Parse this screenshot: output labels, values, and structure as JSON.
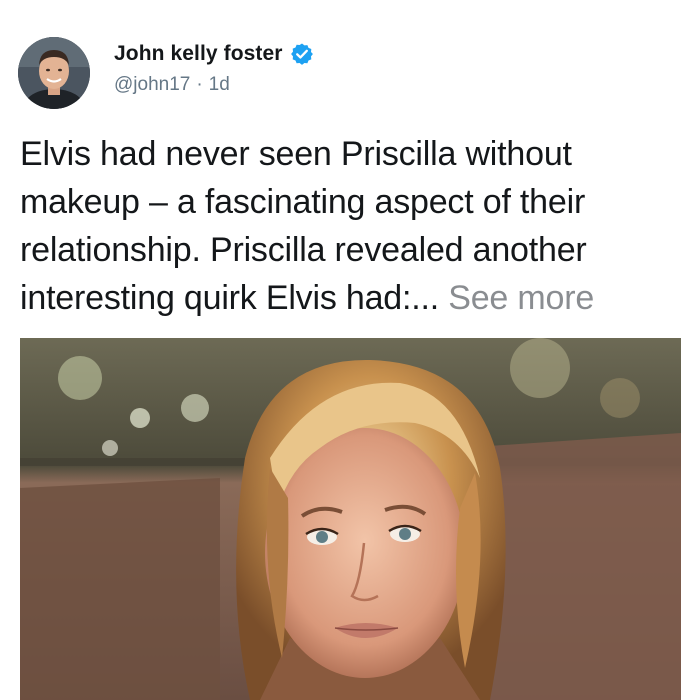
{
  "author": {
    "display_name": "John kelly foster",
    "handle": "@john17",
    "separator": "·",
    "timestamp": "1d",
    "verified_icon": "verified-badge-icon"
  },
  "tweet": {
    "lines": [
      "Elvis had never seen Priscilla without",
      "makeup – a fascinating aspect of their",
      "relationship. Priscilla revealed another",
      "interesting quirk Elvis had:..."
    ],
    "see_more": "See more"
  },
  "colors": {
    "verified": "#1da1f2",
    "muted": "#657786",
    "see_more": "#8a8d91"
  }
}
